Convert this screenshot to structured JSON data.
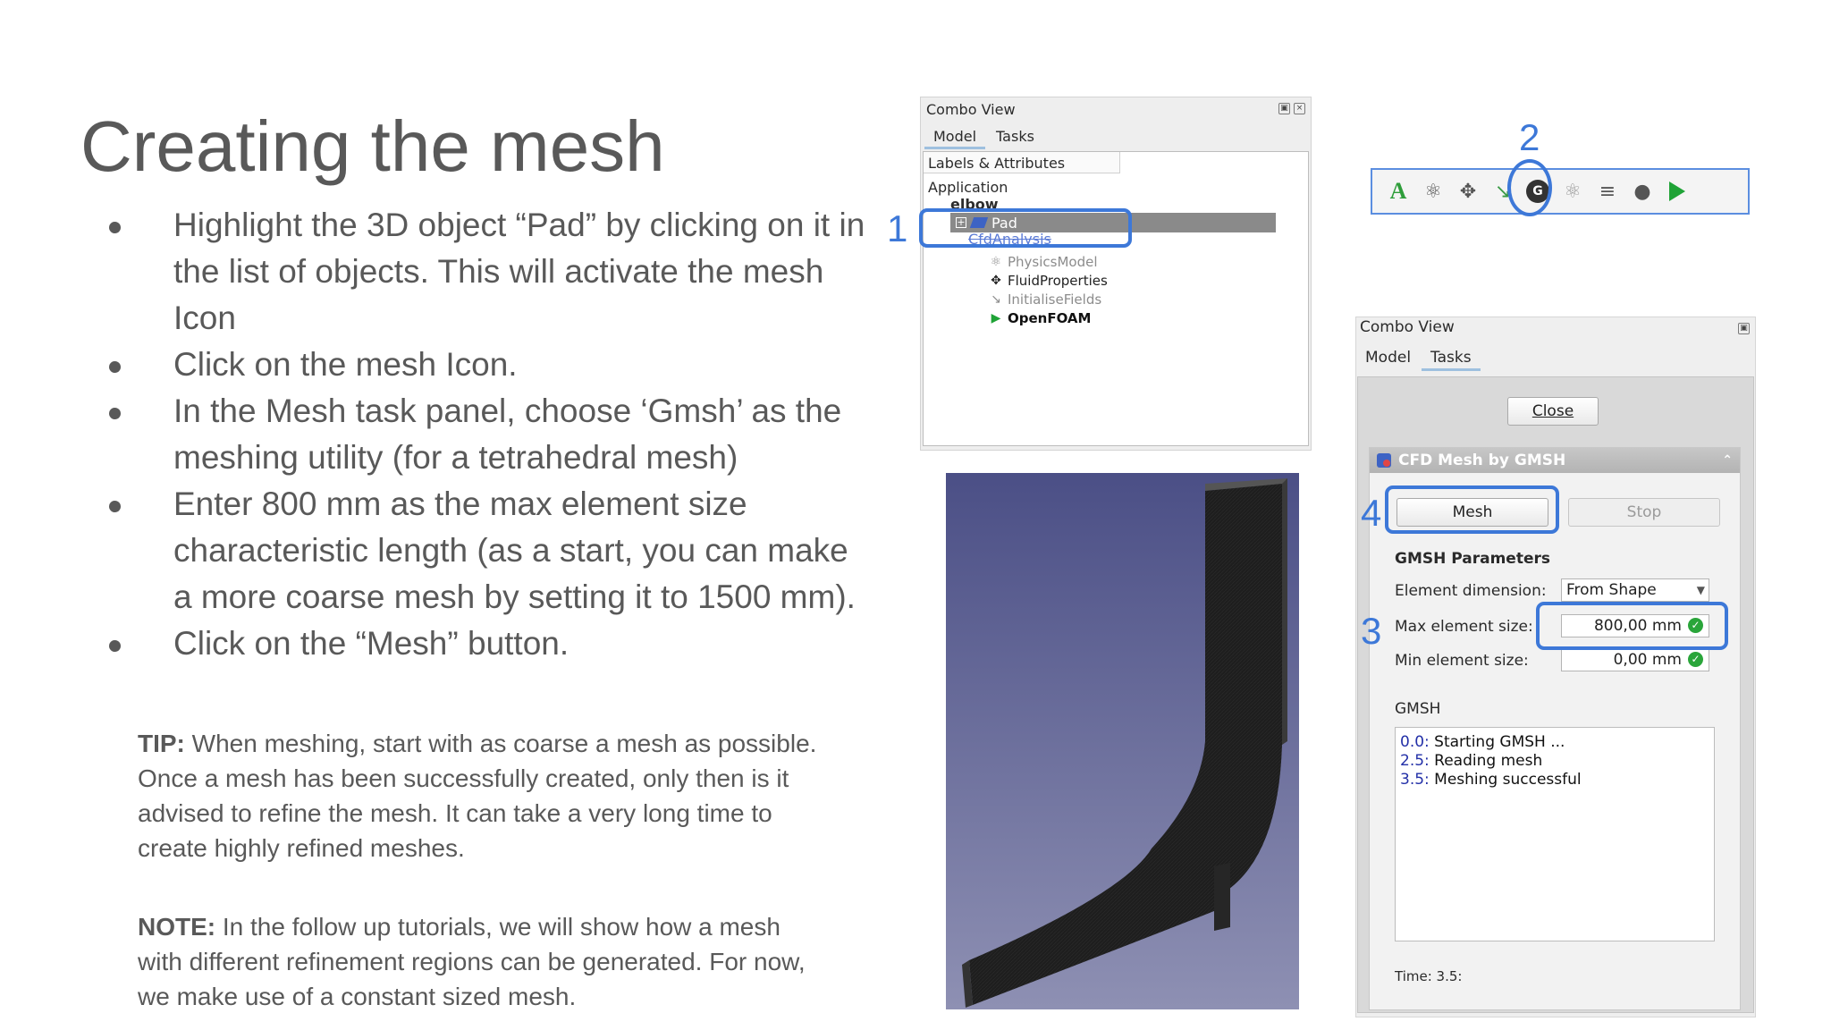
{
  "slide": {
    "title": "Creating the mesh",
    "bullets": [
      "Highlight the 3D object “Pad” by clicking on it in the list of objects. This will activate the mesh Icon",
      "Click on the mesh Icon.",
      "In the Mesh task panel, choose ‘Gmsh’ as the meshing utility (for a tetrahedral mesh)",
      "Enter 800 mm as the max element size characteristic length (as a start, you can make a more coarse mesh by setting it to 1500 mm).",
      "Click on the “Mesh” button."
    ],
    "tip_label": "TIP:",
    "tip_text": " When meshing, start with as coarse a mesh as possible. Once a mesh has been successfully created, only then is it advised to refine the mesh. It can take a very long time to create highly refined meshes.",
    "note_label": "NOTE:",
    "note_text": " In the follow up tutorials, we will show how a mesh with different refinement regions can be generated. For now, we make use of a constant sized mesh."
  },
  "callouts": [
    "1",
    "2",
    "3",
    "4"
  ],
  "combo_view_tree": {
    "title": "Combo View",
    "tabs": [
      "Model",
      "Tasks"
    ],
    "column_header": "Labels & Attributes",
    "application_label": "Application",
    "items": {
      "elbow": "elbow",
      "pad": "Pad",
      "cfd_analysis": "CfdAnalysis",
      "physics_model": "PhysicsModel",
      "fluid_properties": "FluidProperties",
      "initialise_fields": "InitialiseFields",
      "openfoam": "OpenFOAM"
    }
  },
  "toolbar": {
    "icons": [
      "cfd-analysis-icon",
      "physics-model-icon",
      "fluid-properties-icon",
      "initialise-fields-icon",
      "gmsh-mesh-icon",
      "mesh-region-icon",
      "boundary-icon",
      "porous-zone-icon",
      "solver-run-icon"
    ],
    "cfd_label": "A",
    "gmsh_label": "G"
  },
  "combo_view_tasks": {
    "title": "Combo View",
    "tabs": [
      "Model",
      "Tasks"
    ],
    "close_label": "Close",
    "panel_title": "CFD Mesh by GMSH",
    "mesh_label": "Mesh",
    "stop_label": "Stop",
    "params_heading": "GMSH Parameters",
    "element_dimension_label": "Element dimension:",
    "element_dimension_value": "From Shape",
    "max_size_label": "Max element size:",
    "max_size_value": "800,00 mm",
    "min_size_label": "Min element size:",
    "min_size_value": "0,00 mm",
    "log_heading": "GMSH",
    "log": [
      {
        "t": "0.0:",
        "msg": " Starting GMSH ..."
      },
      {
        "t": "2.5:",
        "msg": " Reading mesh"
      },
      {
        "t": "3.5:",
        "msg": " Meshing successful"
      }
    ],
    "time_label": "Time: 3.5:"
  },
  "colors": {
    "callout": "#3d78d8",
    "slide_text": "#595959",
    "render_top": "#4b4f86",
    "render_bottom": "#8e90b3"
  }
}
